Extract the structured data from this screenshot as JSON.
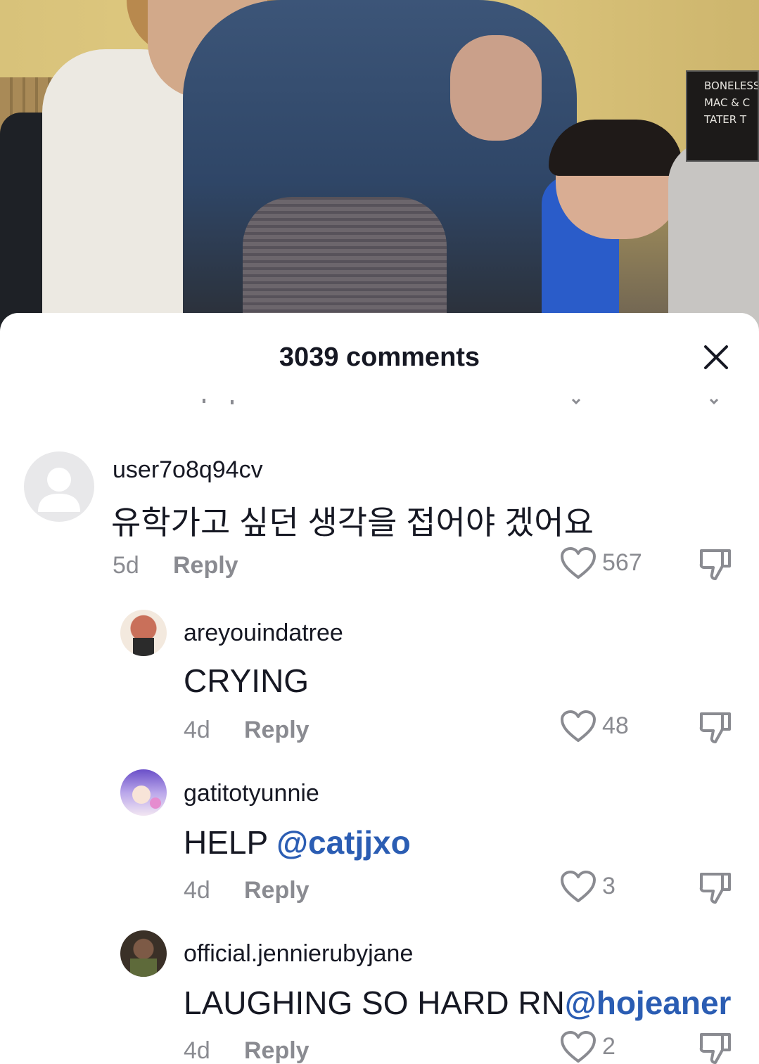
{
  "video": {
    "sign_lines": [
      "BONELESS",
      "MAC & C",
      "TATER T"
    ]
  },
  "sheet": {
    "title": "3039 comments",
    "close_icon": "close-icon"
  },
  "comments": [
    {
      "username": "user7o8q94cv",
      "text": "유학가고 싶던 생각을 접어야 겠어요",
      "mention": "",
      "time": "5d",
      "reply_label": "Reply",
      "likes": "567",
      "avatar": "default-avatar"
    },
    {
      "username": "areyouindatree",
      "text": "CRYING",
      "mention": "",
      "time": "4d",
      "reply_label": "Reply",
      "likes": "48",
      "avatar": "user-avatar"
    },
    {
      "username": "gatitotyunnie",
      "text": "HELP ",
      "mention": "@catjjxo",
      "time": "4d",
      "reply_label": "Reply",
      "likes": "3",
      "avatar": "anime-avatar"
    },
    {
      "username": "official.jennierubyjane",
      "text": "LAUGHING SO HARD RN",
      "mention": "@hojeaner",
      "time": "4d",
      "reply_label": "Reply",
      "likes": "2",
      "avatar": "user-avatar"
    }
  ],
  "colors": {
    "text": "#161823",
    "secondary": "#8a8b91",
    "mention": "#2b5db3"
  }
}
